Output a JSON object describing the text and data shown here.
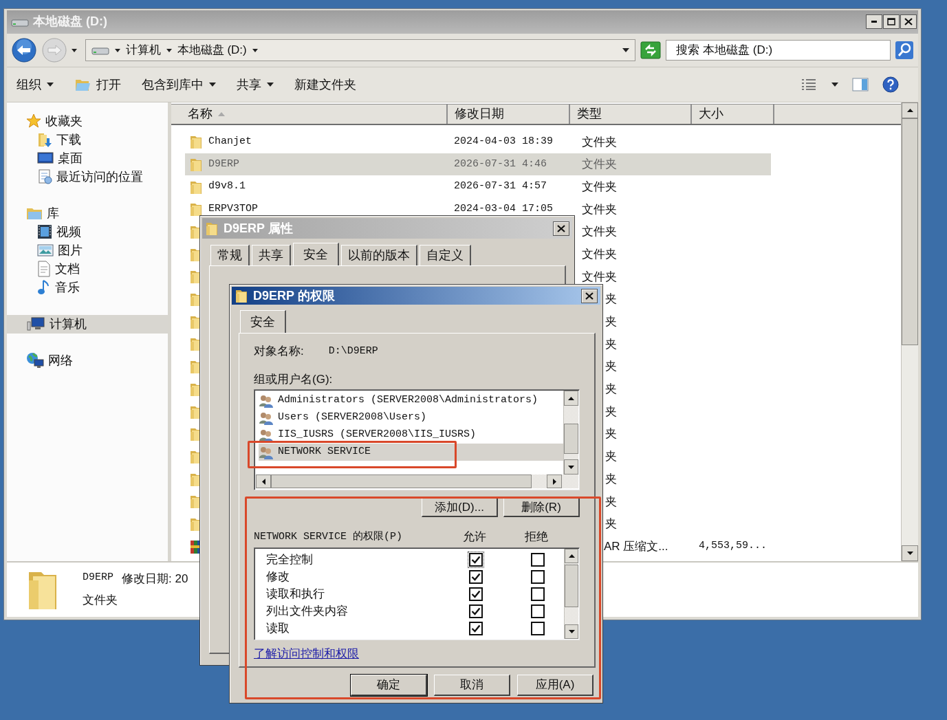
{
  "window": {
    "title": "本地磁盘 (D:)"
  },
  "address_bar": {
    "crumbs": [
      "计算机",
      "本地磁盘 (D:)"
    ]
  },
  "search": {
    "placeholder": "搜索 本地磁盘 (D:)"
  },
  "toolbar": [
    {
      "label": "组织",
      "kind": "menu"
    },
    {
      "label": "打开",
      "kind": "open"
    },
    {
      "label": "包含到库中",
      "kind": "menu"
    },
    {
      "label": "共享",
      "kind": "menu"
    },
    {
      "label": "新建文件夹",
      "kind": "command"
    }
  ],
  "sidebar": {
    "items": [
      {
        "label": "收藏夹",
        "kind": "favorites",
        "selected": false,
        "children": [
          {
            "label": "下载",
            "kind": "downloads",
            "selected": false
          },
          {
            "label": "桌面",
            "kind": "desktop",
            "selected": false
          },
          {
            "label": "最近访问的位置",
            "kind": "recent",
            "selected": false
          }
        ]
      },
      {
        "label": "库",
        "kind": "libraries",
        "selected": false,
        "children": [
          {
            "label": "视频",
            "kind": "videos",
            "selected": false
          },
          {
            "label": "图片",
            "kind": "pictures",
            "selected": false
          },
          {
            "label": "文档",
            "kind": "documents",
            "selected": false
          },
          {
            "label": "音乐",
            "kind": "music",
            "selected": false
          }
        ]
      },
      {
        "label": "计算机",
        "kind": "computer",
        "selected": true
      },
      {
        "label": "网络",
        "kind": "network",
        "selected": false
      }
    ]
  },
  "file_list": {
    "columns": [
      {
        "label": "名称",
        "sorted": true
      },
      {
        "label": "修改日期",
        "sorted": false
      },
      {
        "label": "类型",
        "sorted": false
      },
      {
        "label": "大小",
        "sorted": false
      }
    ],
    "rows": [
      {
        "kind": "folder",
        "name": "Chanjet",
        "modified": "2024-04-03 18:39",
        "type": "文件夹",
        "selected": false
      },
      {
        "kind": "folder",
        "name": "D9ERP",
        "modified": "2026-07-31 4:46",
        "type": "文件夹",
        "selected": true
      },
      {
        "kind": "folder",
        "name": "d9v8.1",
        "modified": "2026-07-31 4:57",
        "type": "文件夹",
        "selected": false
      },
      {
        "kind": "folder",
        "name": "ERPV3TOP",
        "modified": "2024-03-04 17:05",
        "type": "文件夹",
        "selected": false
      },
      {
        "kind": "folder",
        "type": "文件夹",
        "selected": false
      },
      {
        "kind": "folder",
        "type": "文件夹",
        "selected": false
      },
      {
        "kind": "folder",
        "type": "文件夹",
        "selected": false
      },
      {
        "kind": "folder",
        "type": "夹",
        "selected": false
      },
      {
        "kind": "folder",
        "type": "夹",
        "selected": false
      },
      {
        "kind": "folder",
        "type": "夹",
        "selected": false
      },
      {
        "kind": "folder",
        "type": "夹",
        "selected": false
      },
      {
        "kind": "folder",
        "type": "夹",
        "selected": false
      },
      {
        "kind": "folder",
        "type": "夹",
        "selected": false
      },
      {
        "kind": "folder",
        "type": "夹",
        "selected": false
      },
      {
        "kind": "folder",
        "type": "夹",
        "selected": false
      },
      {
        "kind": "folder",
        "type": "夹",
        "selected": false
      },
      {
        "kind": "folder",
        "type": "夹",
        "selected": false
      },
      {
        "kind": "folder",
        "type": "夹",
        "selected": false
      },
      {
        "kind": "archive",
        "type": "AR 压缩文...",
        "size": "4,553,59...",
        "selected": false
      }
    ]
  },
  "details_pane": {
    "name": "D9ERP",
    "modified": "修改日期: 20",
    "type": "文件夹"
  },
  "properties_dialog": {
    "title": "D9ERP 属性",
    "tabs": [
      {
        "label": "常规",
        "selected": false
      },
      {
        "label": "共享",
        "selected": false
      },
      {
        "label": "安全",
        "selected": true
      },
      {
        "label": "以前的版本",
        "selected": false
      },
      {
        "label": "自定义",
        "selected": false
      }
    ]
  },
  "permissions_dialog": {
    "title": "D9ERP 的权限",
    "tabs": [
      {
        "label": "安全",
        "selected": true
      }
    ],
    "object_label": "对象名称:",
    "object_value": "D:\\D9ERP",
    "groups_label": "组或用户名(G):",
    "groups": [
      {
        "name": "Administrators (SERVER2008\\Administrators)",
        "selected": false
      },
      {
        "name": "Users (SERVER2008\\Users)",
        "selected": false
      },
      {
        "name": "IIS_IUSRS (SERVER2008\\IIS_IUSRS)",
        "selected": false
      },
      {
        "name": "NETWORK SERVICE",
        "selected": true
      }
    ],
    "group_buttons": [
      "添加(D)...",
      "删除(R)"
    ],
    "permissions_label": "NETWORK SERVICE 的权限(P)",
    "allow_header": "允许",
    "deny_header": "拒绝",
    "permissions": [
      {
        "name": "完全控制",
        "allow": true,
        "deny": false
      },
      {
        "name": "修改",
        "allow": true,
        "deny": false
      },
      {
        "name": "读取和执行",
        "allow": true,
        "deny": false
      },
      {
        "name": "列出文件夹内容",
        "allow": true,
        "deny": false
      },
      {
        "name": "读取",
        "allow": true,
        "deny": false
      }
    ],
    "link": "了解访问控制和权限",
    "buttons": [
      {
        "label": "确定",
        "default": true
      },
      {
        "label": "取消",
        "default": false
      },
      {
        "label": "应用(A)",
        "default": false
      }
    ]
  }
}
